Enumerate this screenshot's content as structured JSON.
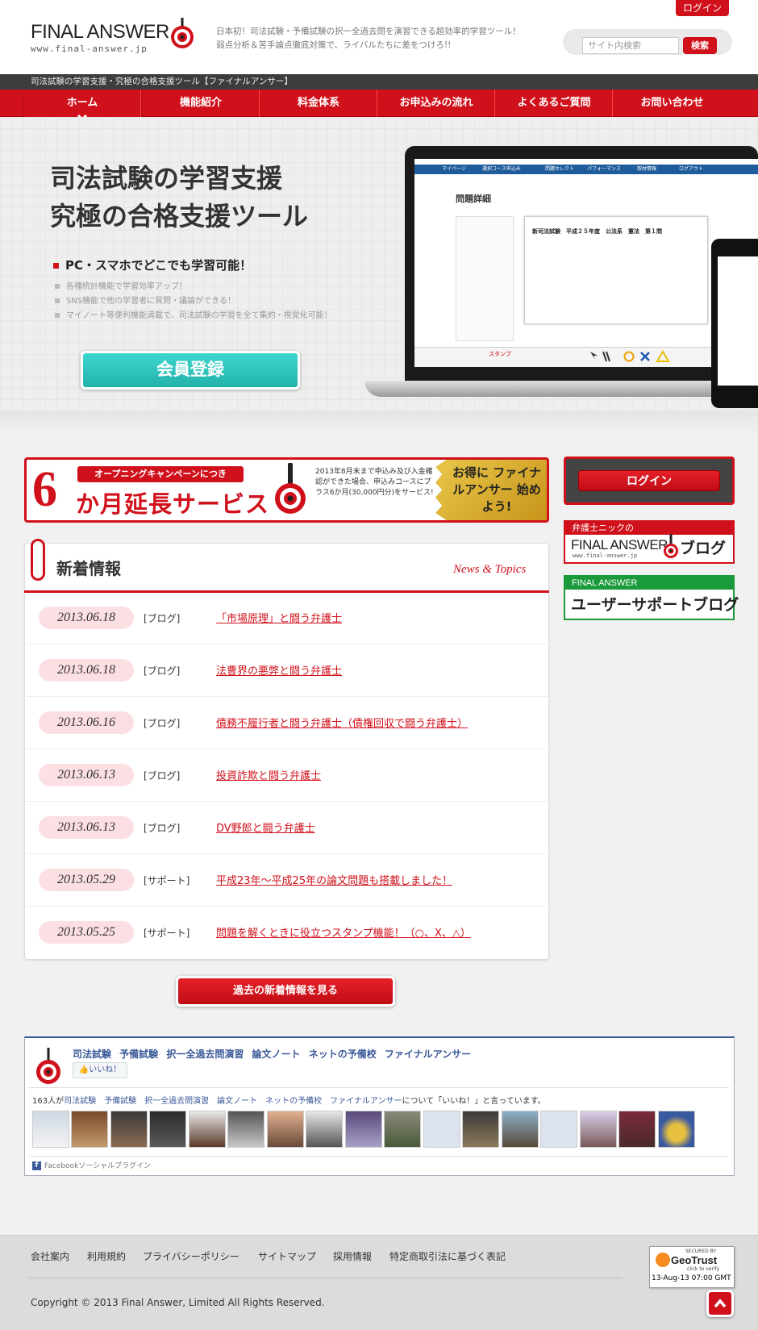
{
  "header": {
    "login_label": "ログイン",
    "logo_text": "FINAL ANSWER",
    "logo_url": "www.final-answer.jp",
    "tagline_line1": "日本初！司法試験・予備試験の択一全過去問を演習できる超効率的学習ツール！",
    "tagline_line2": "弱点分析＆苦手論点徹底対策で、ライバルたちに差をつけろ!!",
    "search_placeholder": "サイト内検索",
    "search_button": "検索",
    "subtitle_bar": "司法試験の学習支援・究極の合格支援ツール【ファイナルアンサー】"
  },
  "nav": {
    "items": [
      {
        "label": "ホーム",
        "active": true
      },
      {
        "label": "機能紹介"
      },
      {
        "label": "料金体系"
      },
      {
        "label": "お申込みの流れ"
      },
      {
        "label": "よくあるご質問"
      },
      {
        "label": "お問い合わせ"
      }
    ]
  },
  "hero": {
    "title_line1": "司法試験の学習支援",
    "title_line2": "究極の合格支援ツール",
    "point": "PC・スマホでどこでも学習可能！",
    "sub_points": [
      "各種統計機能で学習効率アップ！",
      "SNS機能で他の学習者に質問・議論ができる！",
      "マイノート等便利機能満載で、司法試験の学習を全て集約・視覚化可能！"
    ],
    "register_button": "会員登録",
    "screen": {
      "nav_items": [
        "マイページ",
        "選択コース申込み",
        "問題セレクト",
        "パフォーマンス",
        "取材情報",
        "ログアウト"
      ],
      "page_title": "問題詳細",
      "card_title": "新司法試験　平成２５年度　公法系　憲法　第１問",
      "stamp_label": "スタンプ"
    }
  },
  "campaign": {
    "number": "6",
    "pill": "オープニングキャンペーンにつき",
    "main": "か月延長サービス",
    "desc": "2013年8月末まで申込み及び入金確認ができた場合、申込みコースにプラス6か月(30,000円分)をサービス!",
    "gold_text": "お得に ファイナルアンサー 始めよう!"
  },
  "sidebar": {
    "login_button": "ログイン",
    "blog1_top": "弁護士ニックの",
    "blog1_fa": "FINAL ANSWER",
    "blog1_url": "www.final-answer.jp",
    "blog1_blog": "ブログ",
    "blog2_top": "FINAL ANSWER",
    "blog2_main": "ユーザーサポートブログ"
  },
  "news": {
    "title": "新着情報",
    "title_en": "News & Topics",
    "items": [
      {
        "date": "2013.06.18",
        "category": "[ブログ]",
        "title": "「市場原理」と闘う弁護士"
      },
      {
        "date": "2013.06.18",
        "category": "[ブログ]",
        "title": "法曹界の悪弊と闘う弁護士"
      },
      {
        "date": "2013.06.16",
        "category": "[ブログ]",
        "title": "債務不履行者と闘う弁護士（債権回収で闘う弁護士）"
      },
      {
        "date": "2013.06.13",
        "category": "[ブログ]",
        "title": "投資詐欺と闘う弁護士"
      },
      {
        "date": "2013.06.13",
        "category": "[ブログ]",
        "title": "DV野郎と闘う弁護士"
      },
      {
        "date": "2013.05.29",
        "category": "[サポート]",
        "title": "平成23年～平成25年の論文問題も搭載しました！"
      },
      {
        "date": "2013.05.25",
        "category": "[サポート]",
        "title": "問題を解くときに役立つスタンプ機能！（○、X、△）"
      }
    ],
    "past_button": "過去の新着情報を見る"
  },
  "facebook": {
    "page_name": "司法試験 予備試験 択一全過去問演習 論文ノート ネットの予備校 ファイナルアンサー",
    "like_button": "いいね！",
    "count_prefix": "163人が",
    "count_page": "司法試験　予備試験　択一全過去問演習　論文ノート　ネットの予備校　ファイナルアンサー",
    "count_suffix": "について「いいね！」と言っています。",
    "plugin_label": "Facebookソーシャルプラグイン"
  },
  "footer": {
    "links": [
      "会社案内",
      "利用規約",
      "プライバシーポリシー",
      "サイトマップ",
      "採用情報",
      "特定商取引法に基づく表記"
    ],
    "copyright": "Copyright © 2013 Final Answer, Limited All Rights Reserved.",
    "geotrust_secured": "SECURED BY",
    "geotrust_name": "GeoTrust",
    "geotrust_click": "click to verify",
    "geotrust_date": "13-Aug-13 07:00 GMT"
  },
  "colors": {
    "brand_red": "#d0111b",
    "teal": "#2cc5bd",
    "green": "#1a9a3a",
    "facebook_blue": "#3b5998"
  }
}
